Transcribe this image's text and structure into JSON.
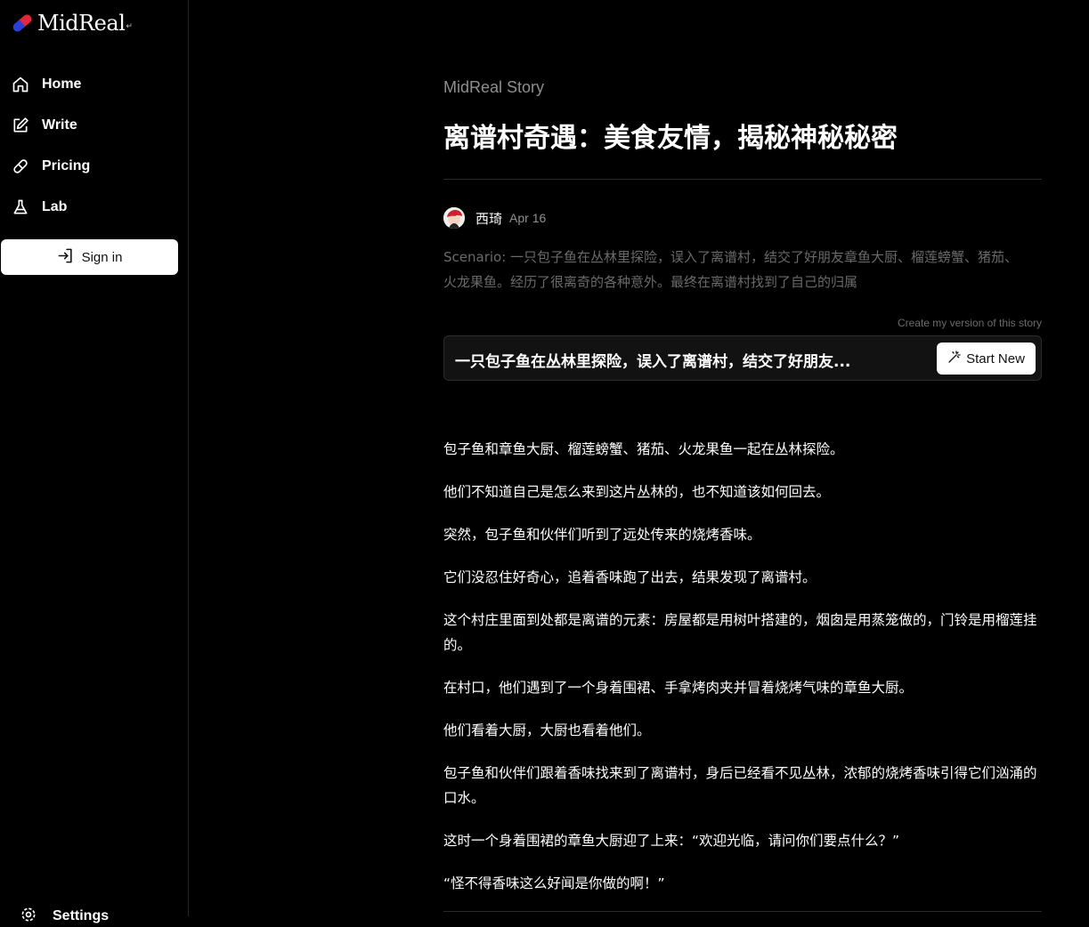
{
  "brand": {
    "name": "MidReal",
    "mark": "↵"
  },
  "sidebar": {
    "items": [
      {
        "label": "Home",
        "icon": "home-icon"
      },
      {
        "label": "Write",
        "icon": "edit-icon"
      },
      {
        "label": "Pricing",
        "icon": "pill-icon"
      },
      {
        "label": "Lab",
        "icon": "flask-icon"
      }
    ],
    "sign_in": "Sign in",
    "settings": "Settings"
  },
  "story": {
    "label": "MidReal Story",
    "title": "离谱村奇遇：美食友情，揭秘神秘秘密",
    "author": "西琦",
    "date": "Apr 16",
    "scenario": "Scenario: 一只包子鱼在丛林里探险，误入了离谱村，结交了好朋友章鱼大厨、榴莲螃蟹、猪茄、火龙果鱼。经历了很离奇的各种意外。最终在离谱村找到了自己的归属",
    "create_label": "Create my version of this story",
    "prompt": "一只包子鱼在丛林里探险，误入了离谱村，结交了好朋友...",
    "start_new": "Start New",
    "paragraphs": [
      "包子鱼和章鱼大厨、榴莲螃蟹、猪茄、火龙果鱼一起在丛林探险。",
      "他们不知道自己是怎么来到这片丛林的，也不知道该如何回去。",
      "突然，包子鱼和伙伴们听到了远处传来的烧烤香味。",
      "它们没忍住好奇心，追着香味跑了出去，结果发现了离谱村。",
      "这个村庄里面到处都是离谱的元素：房屋都是用树叶搭建的，烟囱是用蒸笼做的，门铃是用榴莲挂的。",
      "在村口，他们遇到了一个身着围裙、手拿烤肉夹并冒着烧烤气味的章鱼大厨。",
      "他们看着大厨，大厨也看着他们。",
      "包子鱼和伙伴们跟着香味找来到了离谱村，身后已经看不见丛林，浓郁的烧烤香味引得它们汹涌的口水。",
      "这时一个身着围裙的章鱼大厨迎了上来：“欢迎光临，请问你们要点什么？”",
      "“怪不得香味这么好闻是你做的啊！”"
    ]
  },
  "colors": {
    "background": "#000000",
    "muted": "#8f8f8f",
    "logo_red": "#e3263b",
    "logo_blue": "#2b3fd6"
  }
}
